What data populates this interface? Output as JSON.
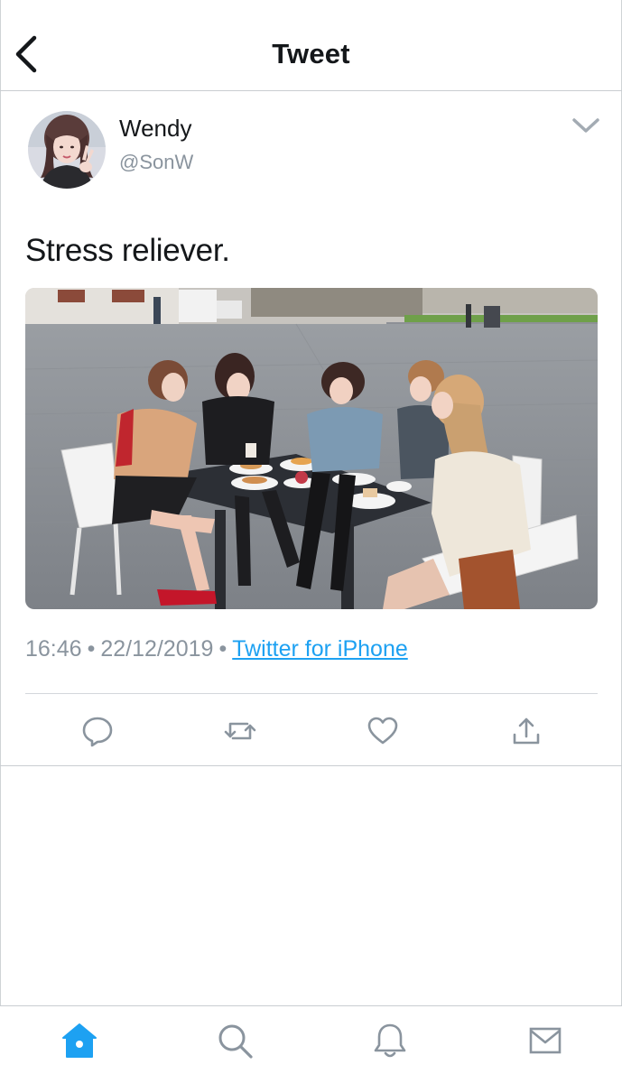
{
  "nav": {
    "title": "Tweet",
    "back_icon": "chevron-left-icon"
  },
  "tweet": {
    "author": {
      "name": "Wendy",
      "handle": "@SonW"
    },
    "text": "Stress reliever.",
    "time": "16:46",
    "separator": "•",
    "date": "22/12/2019",
    "source": "Twitter for iPhone",
    "photo": "photo of five women seated at an outdoor table in a cobblestone square"
  },
  "actions": [
    "reply-icon",
    "retweet-icon",
    "like-icon",
    "share-icon"
  ],
  "tabs": [
    "home-icon",
    "search-icon",
    "notifications-icon",
    "messages-icon"
  ],
  "colors": {
    "accent": "#1da1f2",
    "icon_gray": "#8a949e",
    "text": "#14171a",
    "divider": "#d3d7db"
  }
}
